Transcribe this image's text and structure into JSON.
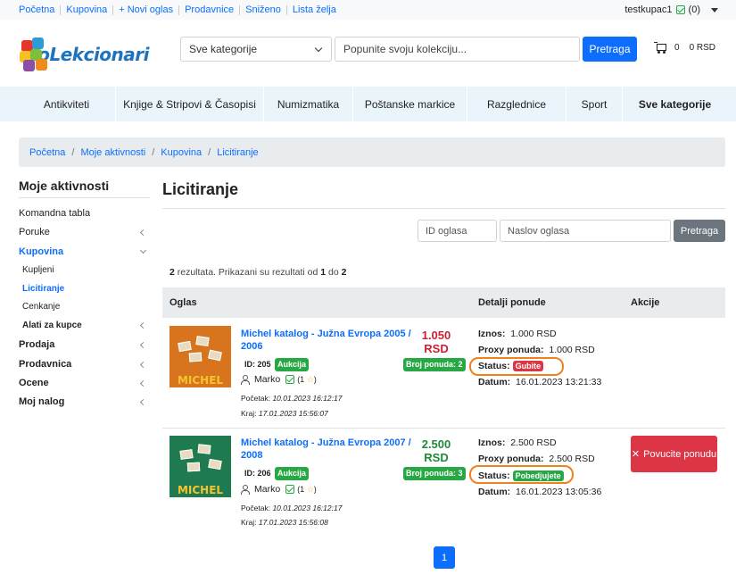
{
  "topnav": [
    "Početna",
    "Kupovina",
    "+ Novi oglas",
    "Prodavnice",
    "Sniženo",
    "Lista želja"
  ],
  "user": {
    "name": "testkupac1",
    "count": "(0)"
  },
  "header": {
    "logo_text": "KoLekcionari",
    "category_select": "Sve kategorije",
    "search_placeholder": "Popunite svoju kolekciju...",
    "search_button": "Pretraga",
    "cart_count": "0",
    "cart_total": "0 RSD"
  },
  "categories": [
    "Antikviteti",
    "Knjige & Stripovi & Časopisi",
    "Numizmatika",
    "Poštanske markice",
    "Razglednice",
    "Sport",
    "Sve kategorije"
  ],
  "breadcrumb": [
    "Početna",
    "Moje aktivnosti",
    "Kupovina",
    "Licitiranje"
  ],
  "sidebar": {
    "title": "Moje aktivnosti",
    "items": {
      "dashboard": "Komandna tabla",
      "messages": "Poruke",
      "buying": "Kupovina",
      "bought": "Kupljeni",
      "bidding": "Licitiranje",
      "haggling": "Cenkanje",
      "tools": "Alati za kupce",
      "selling": "Prodaja",
      "shop": "Prodavnica",
      "ratings": "Ocene",
      "account": "Moj nalog"
    }
  },
  "main": {
    "title": "Licitiranje",
    "filter_id_placeholder": "ID oglasa",
    "filter_title_placeholder": "Naslov oglasa",
    "filter_button": "Pretraga",
    "results": {
      "total": "2",
      "text1": " rezultata. Prikazani su rezultati od ",
      "from": "1",
      "text2": " do ",
      "to": "2"
    },
    "columns": [
      "Oglas",
      "Detalji ponude",
      "Akcije"
    ]
  },
  "rows": [
    {
      "title": "Michel katalog - Južna Evropa 2005 / 2006",
      "price": "1.050 RSD",
      "price_color": "#c82333",
      "id": "ID: 205",
      "type": "Aukcija",
      "bids": "Broj ponuda: 2",
      "seller": "Marko",
      "rating": "(1",
      "rating_end": ")",
      "start_label": "Početak: ",
      "start": "10.01.2023 16:12:17",
      "end_label": "Kraj: ",
      "end": "17.01.2023 15:56:07",
      "amount_label": "Iznos:",
      "amount": "1.000 RSD",
      "proxy_label": "Proxy ponuda:",
      "proxy": "1.000 RSD",
      "status_label": "Status:",
      "status": "Gubite",
      "status_color": "#dc3545",
      "date_label": "Datum:",
      "date": "16.01.2023 13:21:33",
      "thumb_color": "#d9741e"
    },
    {
      "title": "Michel katalog - Južna Evropa 2007 / 2008",
      "price": "2.500 RSD",
      "price_color": "#1e8a3a",
      "id": "ID: 206",
      "type": "Aukcija",
      "bids": "Broj ponuda: 3",
      "seller": "Marko",
      "rating": "(1",
      "rating_end": ")",
      "start_label": "Početak: ",
      "start": "10.01.2023 16:12:17",
      "end_label": "Kraj: ",
      "end": "17.01.2023 15:56:08",
      "amount_label": "Iznos:",
      "amount": "2.500 RSD",
      "proxy_label": "Proxy ponuda:",
      "proxy": "2.500 RSD",
      "status_label": "Status:",
      "status": "Pobedjujete",
      "status_color": "#28a745",
      "date_label": "Datum:",
      "date": "16.01.2023 13:05:36",
      "action": "Povucite ponudu",
      "thumb_color": "#1f7a4f"
    }
  ],
  "thumb_text": "MICHEL",
  "pagination": "1"
}
